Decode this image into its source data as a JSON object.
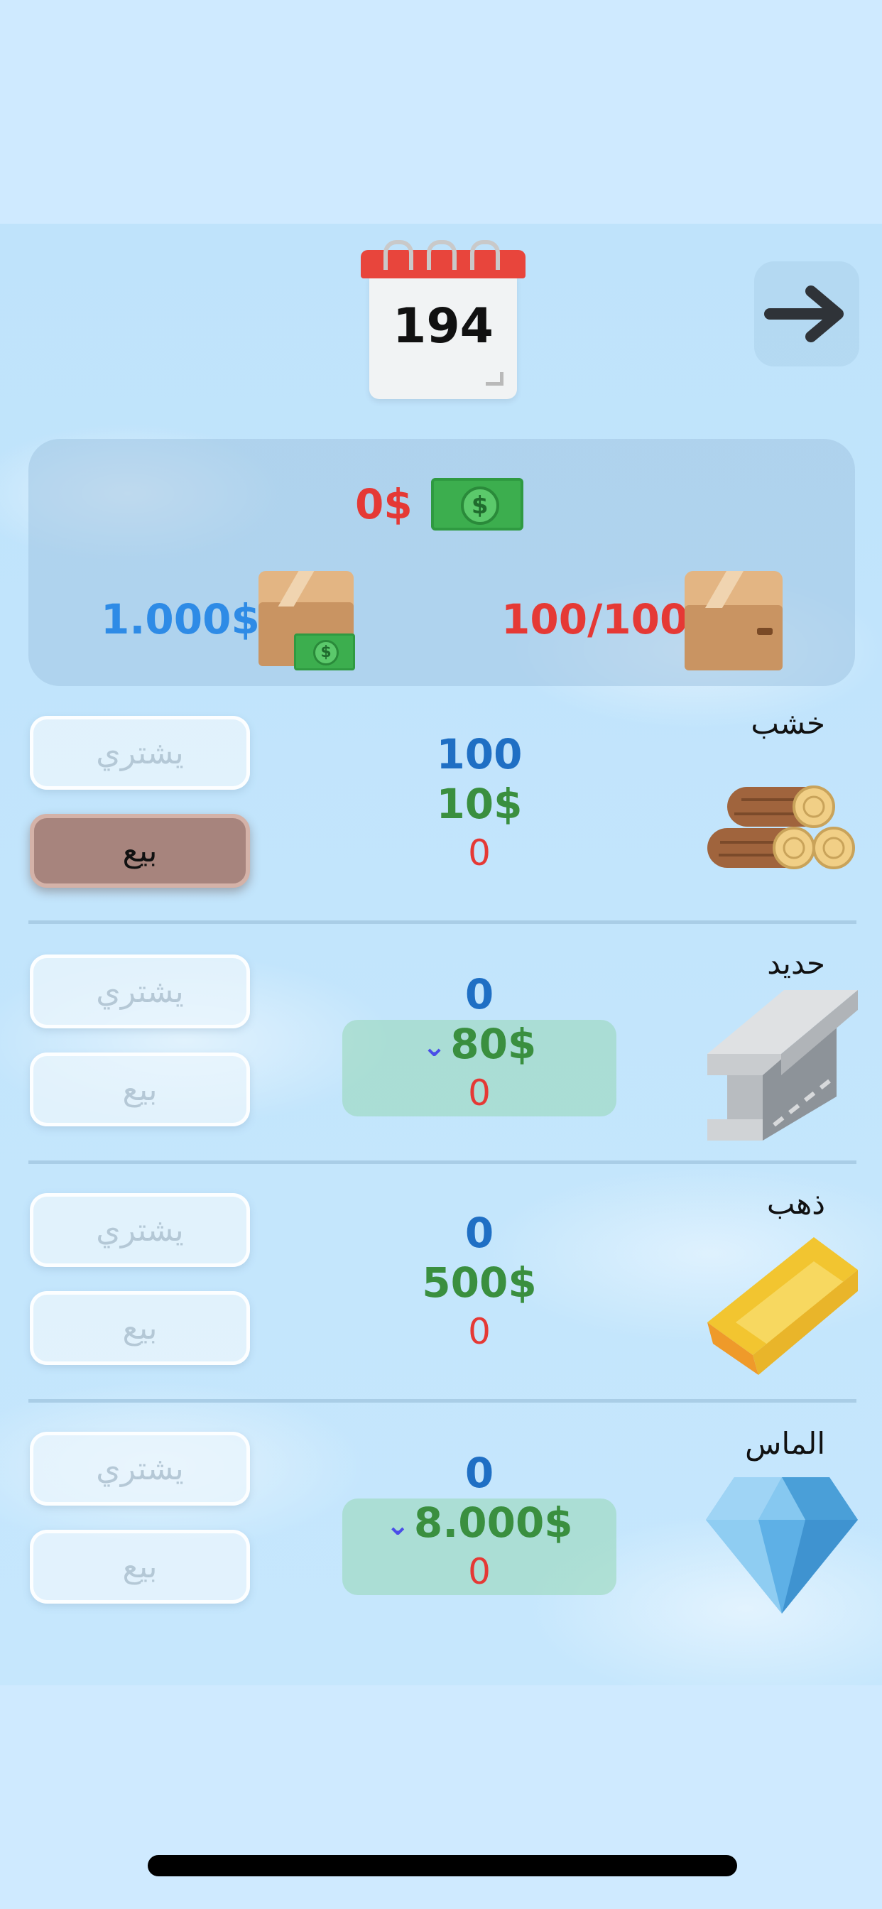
{
  "header": {
    "day": "194",
    "next_icon": "arrow-right-icon"
  },
  "money": {
    "cash": "0$",
    "storage_value": "1.000$",
    "capacity": "100/100"
  },
  "items": [
    {
      "name": "خشب",
      "icon": "wood-logs-icon",
      "quantity": "100",
      "price": "10$",
      "owned": "0",
      "buy_label": "يشتري",
      "sell_label": "بيع",
      "buy_enabled": false,
      "sell_enabled": true,
      "price_trend": "none"
    },
    {
      "name": "حديد",
      "icon": "iron-beam-icon",
      "quantity": "0",
      "price": "80$",
      "owned": "0",
      "buy_label": "يشتري",
      "sell_label": "بيع",
      "buy_enabled": false,
      "sell_enabled": false,
      "price_trend": "down"
    },
    {
      "name": "ذهب",
      "icon": "gold-bar-icon",
      "quantity": "0",
      "price": "500$",
      "owned": "0",
      "buy_label": "يشتري",
      "sell_label": "بيع",
      "buy_enabled": false,
      "sell_enabled": false,
      "price_trend": "none"
    },
    {
      "name": "الماس",
      "icon": "diamond-icon",
      "quantity": "0",
      "price": "8.000$",
      "owned": "0",
      "buy_label": "يشتري",
      "sell_label": "بيع",
      "buy_enabled": false,
      "sell_enabled": false,
      "price_trend": "down"
    }
  ],
  "colors": {
    "background": "#cfeaff",
    "cash": "#e53935",
    "storage_value": "#2e8be6",
    "price": "#3a8f3f",
    "quantity": "#1f6fc4",
    "trend_down": "#4a4de8",
    "sell_active": "#a7847d"
  }
}
